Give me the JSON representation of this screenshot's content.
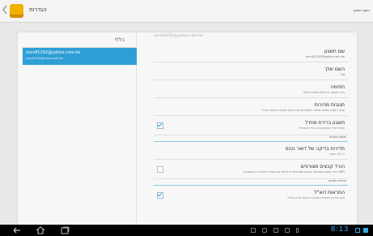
{
  "topbar": {
    "title": "הגדרות",
    "right_text": "הוסף חשבון"
  },
  "left": {
    "header": "כללי",
    "account": {
      "email": "zxcv81202@yahoo.com.tw",
      "sub": "zxcv81202@yahoo.com.tw"
    }
  },
  "right": {
    "email_header": "zxcv81202@yahoo.com.tw",
    "rows": [
      {
        "title": "שם חשבון",
        "sub": "zxcv81202@yahoo.com.tw"
      },
      {
        "title": "השם שלך",
        "sub": "Qq"
      },
      {
        "title": "חתימה",
        "sub": "צרף טקסט להודעות שאתה שולח"
      },
      {
        "title": "תגובות מהירות",
        "sub": "ערוך טקסט שאתה מוסיף לעתים קרובות בזמן כתיבת הודעות דוא\"ל"
      },
      {
        "title": "חשבון ברירת מחדל",
        "sub": "שלח דוא\"ל מחשבון זה כברירת מחדל",
        "checked": true
      }
    ],
    "section_sync": "שימוש בנתונים",
    "rows2": [
      {
        "title": "תדירות בדיקה של דואר נכנס",
        "sub": "כל 15 דקות"
      },
      {
        "title": "הורד קבצים מצורפים",
        "sub": "הורד באופן אוטומטי קבצים מצורפים להודעות שהתקבלו לאחרונה באמצעות WiFi",
        "checked": false
      }
    ],
    "section_notify": "הגדרות התראה",
    "rows3": [
      {
        "title": "התראות דוא\"ל",
        "sub": "הצג הודעה בשורת המערכת כאשר מגיע דוא\"ל",
        "checked": true
      }
    ]
  },
  "statusbar": {
    "clock": "8:13"
  },
  "colors": {
    "accent": "#2f9fd6",
    "clock": "#35a8e8"
  }
}
